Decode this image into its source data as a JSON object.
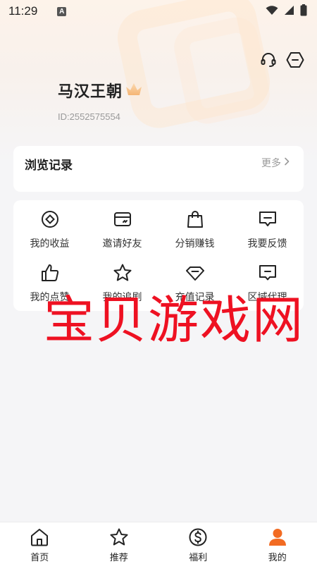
{
  "status_bar": {
    "time": "11:29",
    "badge": "A"
  },
  "header": {
    "actions": [
      {
        "name": "customer-service-icon"
      },
      {
        "name": "settings-hexagon-icon"
      }
    ]
  },
  "profile": {
    "name": "马汉王朝",
    "id_text": "ID:2552575554",
    "badge_icon": "crown-icon"
  },
  "history": {
    "title": "浏览记录",
    "more_label": "更多"
  },
  "grid": {
    "items": [
      {
        "label": "我的收益",
        "icon": "coin-icon"
      },
      {
        "label": "邀请好友",
        "icon": "card-icon"
      },
      {
        "label": "分销赚钱",
        "icon": "shopping-bag-icon"
      },
      {
        "label": "我要反馈",
        "icon": "feedback-icon"
      },
      {
        "label": "我的点赞",
        "icon": "thumbs-up-icon"
      },
      {
        "label": "我的追剧",
        "icon": "star-icon"
      },
      {
        "label": "充值记录",
        "icon": "diamond-icon"
      },
      {
        "label": "区域代理",
        "icon": "message-box-icon"
      }
    ]
  },
  "watermark": {
    "text": "宝贝游戏网"
  },
  "bottom_nav": {
    "items": [
      {
        "label": "首页",
        "icon": "home-icon"
      },
      {
        "label": "推荐",
        "icon": "star-icon"
      },
      {
        "label": "福利",
        "icon": "dollar-icon"
      },
      {
        "label": "我的",
        "icon": "person-icon",
        "active": true
      }
    ]
  },
  "colors": {
    "accent": "#f26b22",
    "watermark": "#ee1122",
    "background": "#f5f5f7"
  }
}
